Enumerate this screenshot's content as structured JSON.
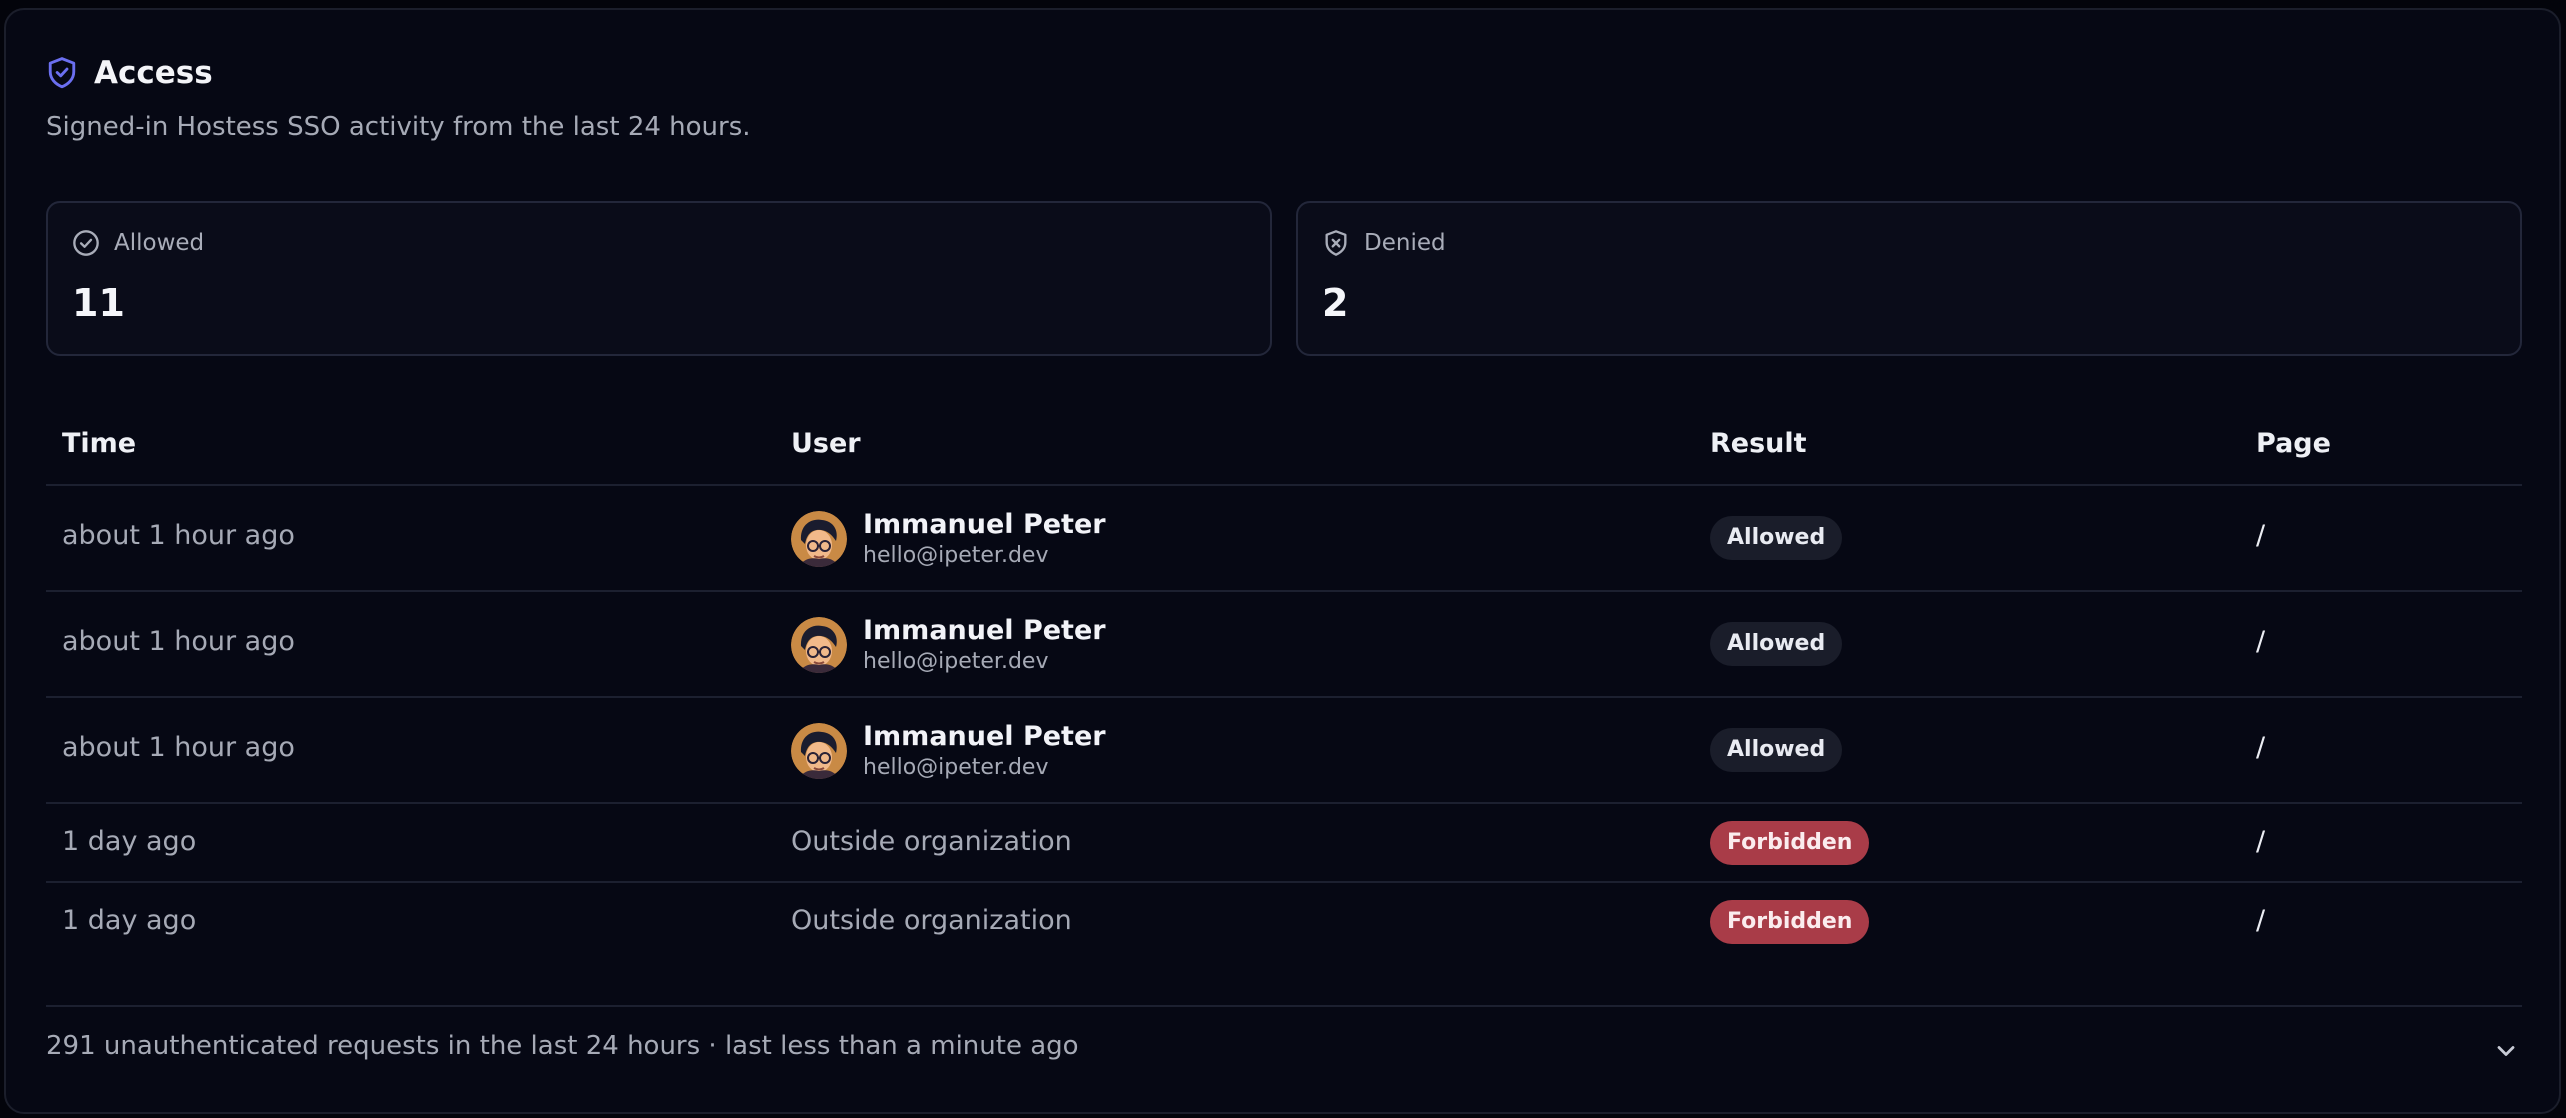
{
  "header": {
    "title": "Access",
    "subtitle": "Signed-in Hostess SSO activity from the last 24 hours.",
    "icon": "shield-check-icon",
    "accent_color": "#6b6ff0"
  },
  "stats": {
    "allowed": {
      "label": "Allowed",
      "value": "11",
      "icon": "check-circle-icon"
    },
    "denied": {
      "label": "Denied",
      "value": "2",
      "icon": "shield-x-icon"
    }
  },
  "table": {
    "columns": [
      "Time",
      "User",
      "Result",
      "Page"
    ],
    "rows": [
      {
        "time": "about 1 hour ago",
        "user_name": "Immanuel Peter",
        "user_email": "hello@ipeter.dev",
        "result": "Allowed",
        "page": "/"
      },
      {
        "time": "about 1 hour ago",
        "user_name": "Immanuel Peter",
        "user_email": "hello@ipeter.dev",
        "result": "Allowed",
        "page": "/"
      },
      {
        "time": "about 1 hour ago",
        "user_name": "Immanuel Peter",
        "user_email": "hello@ipeter.dev",
        "result": "Allowed",
        "page": "/"
      },
      {
        "time": "1 day ago",
        "user_text": "Outside organization",
        "result": "Forbidden",
        "page": "/"
      },
      {
        "time": "1 day ago",
        "user_text": "Outside organization",
        "result": "Forbidden",
        "page": "/"
      }
    ]
  },
  "footer": {
    "text": "291 unauthenticated requests in the last 24 hours · last less than a minute ago",
    "icon": "chevron-down-icon"
  },
  "colors": {
    "background": "#03040b",
    "allowed_badge": "#1a1d2a",
    "forbidden_badge": "#a93c48"
  }
}
